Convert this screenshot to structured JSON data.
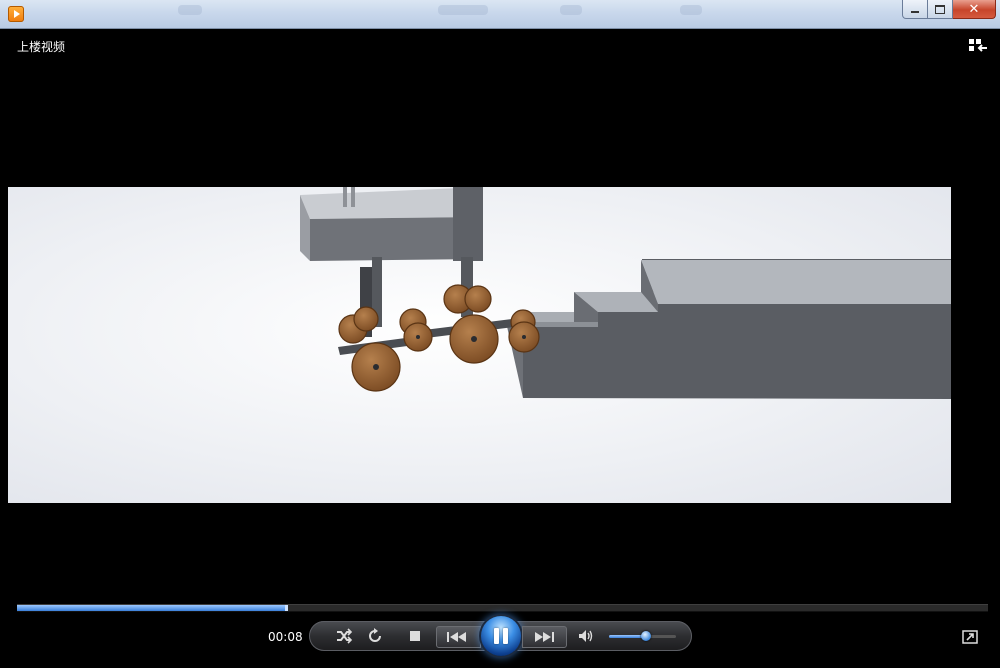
{
  "window": {
    "app_title": "",
    "minimize_icon": "minimize-icon",
    "maximize_icon": "maximize-icon",
    "close_icon": "close-icon"
  },
  "video": {
    "title": "上楼视频"
  },
  "playback": {
    "time": "00:08",
    "progress": 0.277,
    "volume": 0.55,
    "state": "playing"
  },
  "icons": {
    "layout": "switch-to-library-icon",
    "shuffle": "shuffle-icon",
    "repeat": "repeat-icon",
    "stop": "stop-icon",
    "previous": "previous-icon",
    "play_pause": "pause-icon",
    "next": "next-icon",
    "mute": "speaker-icon",
    "fullscreen": "fullscreen-icon"
  },
  "colors": {
    "accent": "#3a7fd9",
    "background": "#000000"
  }
}
